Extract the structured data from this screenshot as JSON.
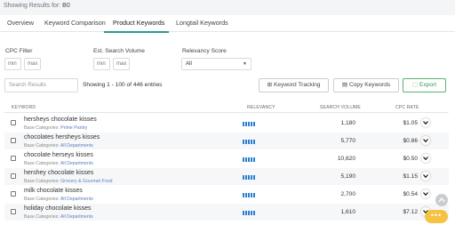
{
  "header": {
    "showing_prefix": "Showing Results for:",
    "showing_value": "B0"
  },
  "tabs": [
    {
      "label": "Overview"
    },
    {
      "label": "Keyword Comparison"
    },
    {
      "label": "Product Keywords"
    },
    {
      "label": "Longtail Keywords"
    }
  ],
  "filters": {
    "cpc_label": "CPC Filter",
    "cpc_min_placeholder": "min",
    "cpc_max_placeholder": "max",
    "vol_label": "Est. Search Volume",
    "vol_min_placeholder": "min",
    "vol_max_placeholder": "max",
    "relevancy_label": "Relevancy Score",
    "relevancy_value": "All"
  },
  "toolbar": {
    "search_placeholder": "Search Results",
    "entries_text": "Showing 1 - 100 of 446 entries",
    "keyword_tracking": "Keyword Tracking",
    "copy_keywords": "Copy Keywords",
    "export": "Export"
  },
  "table": {
    "headers": {
      "keyword": "KEYWORD",
      "relevancy": "RELEVANCY",
      "volume": "SEARCH VOLUME",
      "cpc": "CPC RATE"
    },
    "category_label": "Base Categories:",
    "rows": [
      {
        "keyword": "hersheys chocolate kisses",
        "category": "Prime Pantry",
        "relevancy": 5,
        "volume": "1,180",
        "cpc": "$1.05"
      },
      {
        "keyword": "chocolates hersheys kisses",
        "category": "All Departments",
        "relevancy": 5,
        "volume": "5,770",
        "cpc": "$0.86"
      },
      {
        "keyword": "chocolate herseys kisses",
        "category": "All Departments",
        "relevancy": 5,
        "volume": "10,620",
        "cpc": "$0.50"
      },
      {
        "keyword": "hershey chocolate kisses",
        "category": "Grocery & Gourmet Food",
        "relevancy": 5,
        "volume": "5,190",
        "cpc": "$1.15"
      },
      {
        "keyword": "milk chocolate kisses",
        "category": "All Departments",
        "relevancy": 5,
        "volume": "2,700",
        "cpc": "$0.54"
      },
      {
        "keyword": "holiday chocolate kisses",
        "category": "All Departments",
        "relevancy": 5,
        "volume": "1,610",
        "cpc": "$7.12"
      }
    ]
  },
  "colors": {
    "accent": "#2a9d8f",
    "relevancy_bar": "#2d7fd3",
    "category_link": "#5b7fbd",
    "export_green": "#3a9a4d",
    "chat_bubble": "#f5c242"
  },
  "icons": {
    "tracking": "plus-square-icon",
    "copy": "copy-icon",
    "export": "export-icon",
    "expand": "chevron-down-icon",
    "scroll": "chevron-up-icon",
    "chat": "chat-dots-icon"
  }
}
